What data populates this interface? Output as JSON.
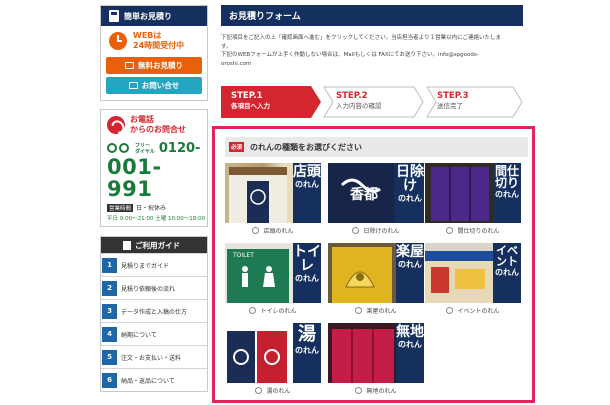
{
  "sidebar": {
    "quote_head": "簡単お見積り",
    "web24": [
      "WEBは",
      "24時間受付中"
    ],
    "quote_btn": "無料お見積り",
    "contact_btn": "お問い合せ",
    "tel_head": [
      "お電話",
      "からのお問合せ"
    ],
    "free_label": [
      "フリー",
      "ダイヤル"
    ],
    "phone1": "0120-",
    "phone2": "001-991",
    "hours_label": "営業時間",
    "hours_days": "日・祝休み",
    "hours_times": "平日 9:00～21:00 土曜 10:00～18:00",
    "guide_head": "ご利用ガイド",
    "guide_items": [
      {
        "num": "1",
        "label": "見積りまでガイド"
      },
      {
        "num": "2",
        "label": "見積り依頼後の流れ"
      },
      {
        "num": "3",
        "label": "データ作成と入稿の仕方"
      },
      {
        "num": "4",
        "label": "納期について"
      },
      {
        "num": "5",
        "label": "注文・お支払い・送料"
      },
      {
        "num": "6",
        "label": "納品・返品について"
      }
    ]
  },
  "main": {
    "form_title": "お見積りフォーム",
    "intro": [
      "下記項目をご記入の上「確認画面へ進む」をクリックしてください。当店担当者より１営業以内にご連絡いたしま",
      "す。",
      "下記のWEBフォームが上手く作動しない場合は、Mailもしくは FAXにてお送り下さい。info@spgoods-",
      "oroshi.com"
    ],
    "steps": [
      {
        "title": "STEP.1",
        "sub": "各項目へ入力"
      },
      {
        "title": "STEP.2",
        "sub": "入力内容の確認"
      },
      {
        "title": "STEP.3",
        "sub": "送信完了"
      }
    ],
    "required": "必須",
    "panel_title": "のれんの種類をお選びください",
    "noren": [
      {
        "big": "店頭",
        "small": "のれん",
        "option": "店頭のれん"
      },
      {
        "big": "日除け",
        "small": "のれん",
        "option": "日除けのれん"
      },
      {
        "big": "間仕切り",
        "small": "のれん",
        "option": "間仕切りのれん"
      },
      {
        "big": "トイレ",
        "small": "のれん",
        "option": "トイレのれん"
      },
      {
        "big": "楽屋",
        "small": "のれん",
        "option": "楽屋のれん"
      },
      {
        "big": "イベント",
        "small": "のれん",
        "option": "イベントのれん"
      },
      {
        "big": "湯",
        "small": "のれん",
        "option": "湯のれん"
      },
      {
        "big": "無地",
        "small": "のれん",
        "option": "無地のれん"
      }
    ],
    "photo_text": {
      "toilet": "TOILET",
      "kasutora": "香都"
    }
  },
  "colors": {
    "navy": "#15305e",
    "orange": "#e8600a",
    "teal": "#25a6c0",
    "red": "#d4262e",
    "green": "#1a7a3c",
    "highlight": "#e2245a"
  }
}
